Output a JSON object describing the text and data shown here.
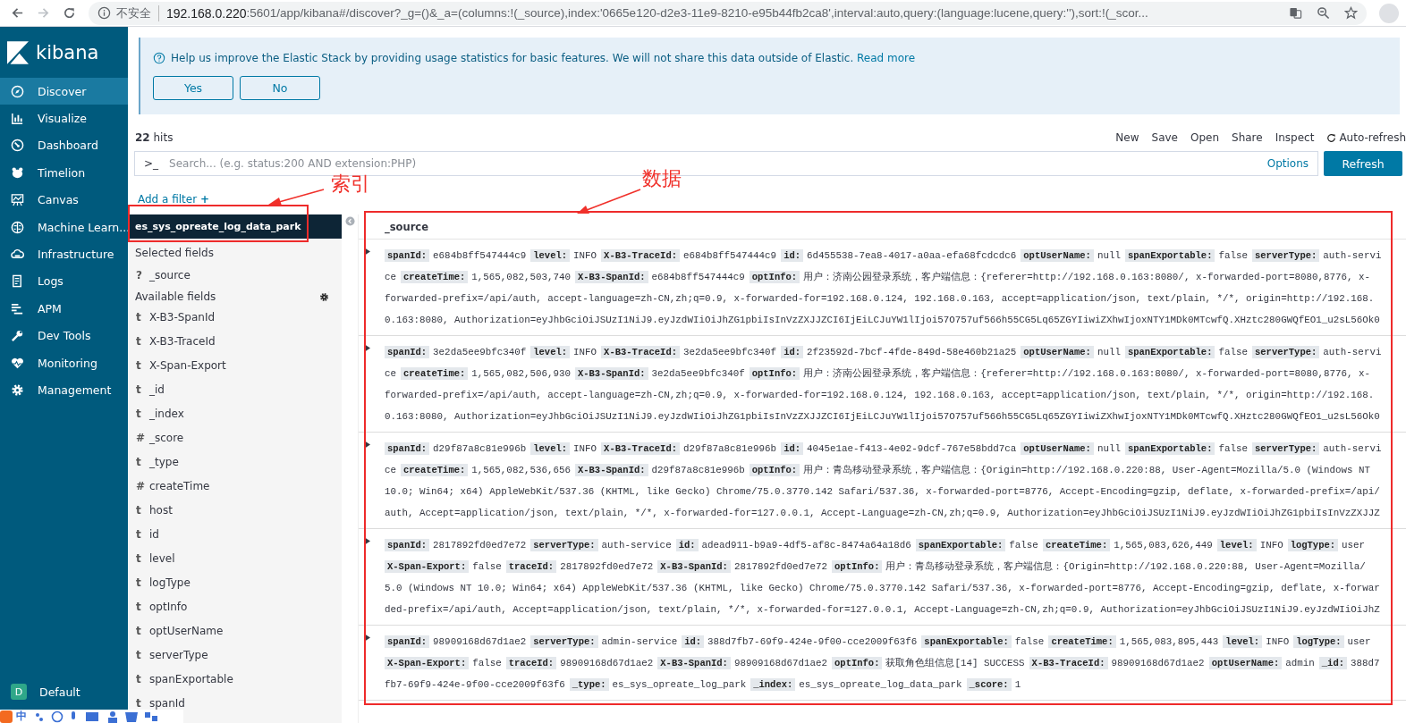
{
  "browser": {
    "security": "不安全",
    "url_host": "192.168.0.220",
    "url_rest": ":5601/app/kibana#/discover?_g=()&_a=(columns:!(_source),index:'0665e120-d2e3-11e9-8210-e95b44fb2ca8',interval:auto,query:(language:lucene,query:''),sort:!(_scor..."
  },
  "sidebar": {
    "logo": "kibana",
    "items": [
      {
        "label": "Discover",
        "selected": true
      },
      {
        "label": "Visualize",
        "selected": false
      },
      {
        "label": "Dashboard",
        "selected": false
      },
      {
        "label": "Timelion",
        "selected": false
      },
      {
        "label": "Canvas",
        "selected": false
      },
      {
        "label": "Machine Learn...",
        "selected": false
      },
      {
        "label": "Infrastructure",
        "selected": false
      },
      {
        "label": "Logs",
        "selected": false
      },
      {
        "label": "APM",
        "selected": false
      },
      {
        "label": "Dev Tools",
        "selected": false
      },
      {
        "label": "Monitoring",
        "selected": false
      },
      {
        "label": "Management",
        "selected": false
      }
    ],
    "space": {
      "badge": "D",
      "label": "Default"
    }
  },
  "banner": {
    "text": "Help us improve the Elastic Stack by providing usage statistics for basic features. We will not share this data outside of Elastic.",
    "link": "Read more",
    "buttons": [
      "Yes",
      "No"
    ]
  },
  "hits": "**22** hits",
  "toolbar": [
    "New",
    "Save",
    "Open",
    "Share",
    "Inspect"
  ],
  "auto_refresh": "Auto-refresh",
  "search": {
    "prompt": ">_",
    "placeholder": "Search... (e.g. status:200 AND extension:PHP)",
    "options": "Options",
    "button": "Refresh"
  },
  "add_filter": {
    "label": "Add a filter",
    "plus": "+"
  },
  "index_name": "es_sys_opreate_log_data_park",
  "selected_fields": {
    "title": "Selected fields",
    "items": [
      {
        "type": "?",
        "name": "_source"
      }
    ]
  },
  "available_fields": {
    "title": "Available fields",
    "items": [
      {
        "type": "t",
        "name": "X-B3-SpanId"
      },
      {
        "type": "t",
        "name": "X-B3-TraceId"
      },
      {
        "type": "t",
        "name": "X-Span-Export"
      },
      {
        "type": "t",
        "name": "_id"
      },
      {
        "type": "t",
        "name": "_index"
      },
      {
        "type": "#",
        "name": "_score"
      },
      {
        "type": "t",
        "name": "_type"
      },
      {
        "type": "#",
        "name": "createTime"
      },
      {
        "type": "t",
        "name": "host"
      },
      {
        "type": "t",
        "name": "id"
      },
      {
        "type": "t",
        "name": "level"
      },
      {
        "type": "t",
        "name": "logType"
      },
      {
        "type": "t",
        "name": "optInfo"
      },
      {
        "type": "t",
        "name": "optUserName"
      },
      {
        "type": "t",
        "name": "serverType"
      },
      {
        "type": "t",
        "name": "spanExportable"
      },
      {
        "type": "t",
        "name": "spanId"
      }
    ]
  },
  "table": {
    "column": "_source",
    "docs": [
      {
        "lines": [
          [
            {
              "key": "spanId:",
              "value": "e684b8ff547444c9"
            },
            {
              "key": "level:",
              "value": "INFO"
            },
            {
              "key": "X-B3-TraceId:",
              "value": "e684b8ff547444c9"
            },
            {
              "key": "id:",
              "value": "6d455538-7ea8-4017-a0aa-efa68fcdcdc6"
            },
            {
              "key": "optUserName:",
              "value": "null"
            },
            {
              "key": "spanExportable:",
              "value": "false"
            },
            {
              "key": "serverType:",
              "value": "auth-servi"
            }
          ],
          [
            {
              "value": "ce"
            },
            {
              "key": "createTime:",
              "value": "1,565,082,503,740"
            },
            {
              "key": "X-B3-SpanId:",
              "value": "e684b8ff547444c9"
            },
            {
              "key": "optInfo:",
              "value": "用户：济南公园登录系统，客户端信息：{referer=http://192.168.0.163:8080/, x-forwarded-port=8080,8776, x-"
            }
          ],
          [
            {
              "value": "forwarded-prefix=/api/auth, accept-language=zh-CN,zh;q=0.9, x-forwarded-for=192.168.0.124, 192.168.0.163, accept=application/json, text/plain, */*, origin=http://192.168."
            }
          ],
          [
            {
              "value": "0.163:8080, Authorization=eyJhbGciOiJSUzI1NiJ9.eyJzdWIiOiJhZG1pbiIsInVzZXJJZCI6IjEiLCJuYW1lIjoi57O757uf566h55CG5Lq65ZGYIiwiZXhwIjoxNTY1MDk0MTcwfQ.XHztc280GWQfEO1_u2sL56Ok0"
            }
          ]
        ]
      },
      {
        "lines": [
          [
            {
              "key": "spanId:",
              "value": "3e2da5ee9bfc340f"
            },
            {
              "key": "level:",
              "value": "INFO"
            },
            {
              "key": "X-B3-TraceId:",
              "value": "3e2da5ee9bfc340f"
            },
            {
              "key": "id:",
              "value": "2f23592d-7bcf-4fde-849d-58e460b21a25"
            },
            {
              "key": "optUserName:",
              "value": "null"
            },
            {
              "key": "spanExportable:",
              "value": "false"
            },
            {
              "key": "serverType:",
              "value": "auth-servi"
            }
          ],
          [
            {
              "value": "ce"
            },
            {
              "key": "createTime:",
              "value": "1,565,082,506,930"
            },
            {
              "key": "X-B3-SpanId:",
              "value": "3e2da5ee9bfc340f"
            },
            {
              "key": "optInfo:",
              "value": "用户：济南公园登录系统，客户端信息：{referer=http://192.168.0.163:8080/, x-forwarded-port=8080,8776, x-"
            }
          ],
          [
            {
              "value": "forwarded-prefix=/api/auth, accept-language=zh-CN,zh;q=0.9, x-forwarded-for=192.168.0.124, 192.168.0.163, accept=application/json, text/plain, */*, origin=http://192.168."
            }
          ],
          [
            {
              "value": "0.163:8080, Authorization=eyJhbGciOiJSUzI1NiJ9.eyJzdWIiOiJhZG1pbiIsInVzZXJJZCI6IjEiLCJuYW1lIjoi57O757uf566h55CG5Lq65ZGYIiwiZXhwIjoxNTY1MDk0MTcwfQ.XHztc280GWQfEO1_u2sL56Ok0"
            }
          ]
        ]
      },
      {
        "lines": [
          [
            {
              "key": "spanId:",
              "value": "d29f87a8c81e996b"
            },
            {
              "key": "level:",
              "value": "INFO"
            },
            {
              "key": "X-B3-TraceId:",
              "value": "d29f87a8c81e996b"
            },
            {
              "key": "id:",
              "value": "4045e1ae-f413-4e02-9dcf-767e58bdd7ca"
            },
            {
              "key": "optUserName:",
              "value": "null"
            },
            {
              "key": "spanExportable:",
              "value": "false"
            },
            {
              "key": "serverType:",
              "value": "auth-servi"
            }
          ],
          [
            {
              "value": "ce"
            },
            {
              "key": "createTime:",
              "value": "1,565,082,536,656"
            },
            {
              "key": "X-B3-SpanId:",
              "value": "d29f87a8c81e996b"
            },
            {
              "key": "optInfo:",
              "value": "用户：青岛移动登录系统，客户端信息：{Origin=http://192.168.0.220:88, User-Agent=Mozilla/5.0 (Windows NT"
            }
          ],
          [
            {
              "value": "10.0; Win64; x64) AppleWebKit/537.36 (KHTML, like Gecko) Chrome/75.0.3770.142 Safari/537.36, x-forwarded-port=8776, Accept-Encoding=gzip, deflate, x-forwarded-prefix=/api/"
            }
          ],
          [
            {
              "value": "auth, Accept=application/json, text/plain, */*, x-forwarded-for=127.0.0.1, Accept-Language=zh-CN,zh;q=0.9, Authorization=eyJhbGciOiJSUzI1NiJ9.eyJzdWIiOiJhZG1pbiIsInVzZXJJZ"
            }
          ]
        ]
      },
      {
        "lines": [
          [
            {
              "key": "spanId:",
              "value": "2817892fd0ed7e72"
            },
            {
              "key": "serverType:",
              "value": "auth-service"
            },
            {
              "key": "id:",
              "value": "adead911-b9a9-4df5-af8c-8474a64a18d6"
            },
            {
              "key": "spanExportable:",
              "value": "false"
            },
            {
              "key": "createTime:",
              "value": "1,565,083,626,449"
            },
            {
              "key": "level:",
              "value": "INFO"
            },
            {
              "key": "logType:",
              "value": "user"
            }
          ],
          [
            {
              "key": "X-Span-Export:",
              "value": "false"
            },
            {
              "key": "traceId:",
              "value": "2817892fd0ed7e72"
            },
            {
              "key": "X-B3-SpanId:",
              "value": "2817892fd0ed7e72"
            },
            {
              "key": "optInfo:",
              "value": "用户：青岛移动登录系统，客户端信息：{Origin=http://192.168.0.220:88, User-Agent=Mozilla/"
            }
          ],
          [
            {
              "value": "5.0 (Windows NT 10.0; Win64; x64) AppleWebKit/537.36 (KHTML, like Gecko) Chrome/75.0.3770.142 Safari/537.36, x-forwarded-port=8776, Accept-Encoding=gzip, deflate, x-forwar"
            }
          ],
          [
            {
              "value": "ded-prefix=/api/auth, Accept=application/json, text/plain, */*, x-forwarded-for=127.0.0.1, Accept-Language=zh-CN,zh;q=0.9, Authorization=eyJhbGciOiJSUzI1NiJ9.eyJzdWIiOiJhZ"
            }
          ]
        ]
      },
      {
        "lines": [
          [
            {
              "key": "spanId:",
              "value": "98909168d67d1ae2"
            },
            {
              "key": "serverType:",
              "value": "admin-service"
            },
            {
              "key": "id:",
              "value": "388d7fb7-69f9-424e-9f00-cce2009f63f6"
            },
            {
              "key": "spanExportable:",
              "value": "false"
            },
            {
              "key": "createTime:",
              "value": "1,565,083,895,443"
            },
            {
              "key": "level:",
              "value": "INFO"
            },
            {
              "key": "logType:",
              "value": "user"
            }
          ],
          [
            {
              "key": "X-Span-Export:",
              "value": "false"
            },
            {
              "key": "traceId:",
              "value": "98909168d67d1ae2"
            },
            {
              "key": "X-B3-SpanId:",
              "value": "98909168d67d1ae2"
            },
            {
              "key": "optInfo:",
              "value": "获取角色组信息[14] SUCCESS"
            },
            {
              "key": "X-B3-TraceId:",
              "value": "98909168d67d1ae2"
            },
            {
              "key": "optUserName:",
              "value": "admin"
            },
            {
              "key": "_id:",
              "value": "388d7"
            }
          ],
          [
            {
              "value": "fb7-69f9-424e-9f00-cce2009f63f6"
            },
            {
              "key": "_type:",
              "value": "es_sys_opreate_log_park"
            },
            {
              "key": "_index:",
              "value": "es_sys_opreate_log_data_park"
            },
            {
              "key": "_score:",
              "value": "1"
            }
          ]
        ]
      }
    ]
  },
  "annotation_labels": [
    "索引",
    "数据"
  ],
  "ime_bar": {
    "mode": "中"
  }
}
